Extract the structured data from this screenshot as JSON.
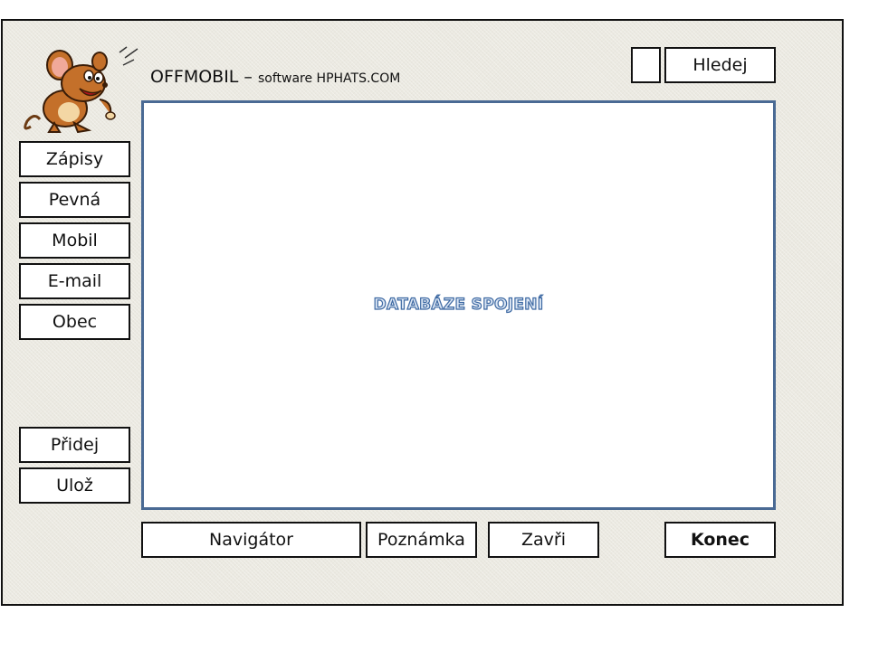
{
  "header": {
    "title_main": "OFFMOBIL – ",
    "title_small": "software HPHATS.COM",
    "search_button": "Hledej",
    "search_box": ""
  },
  "sidebar": {
    "items": [
      {
        "label": "Zápisy"
      },
      {
        "label": "Pevná"
      },
      {
        "label": "Mobil"
      },
      {
        "label": "E-mail"
      },
      {
        "label": "Obec"
      }
    ],
    "actions": [
      {
        "label": "Přidej"
      },
      {
        "label": "Ulož"
      }
    ]
  },
  "main": {
    "label": "DATABÁZE  SPOJENÍ"
  },
  "footer": {
    "navigator": "Navigátor",
    "note": "Poznámka",
    "close": "Zavři",
    "end": "Konec"
  },
  "colors": {
    "panel_border": "#4a6a94",
    "label_outline": "#3f6aa3",
    "background": "#ebe9e1"
  },
  "icons": {
    "mascot": "cartoon-mouse-mascot"
  }
}
